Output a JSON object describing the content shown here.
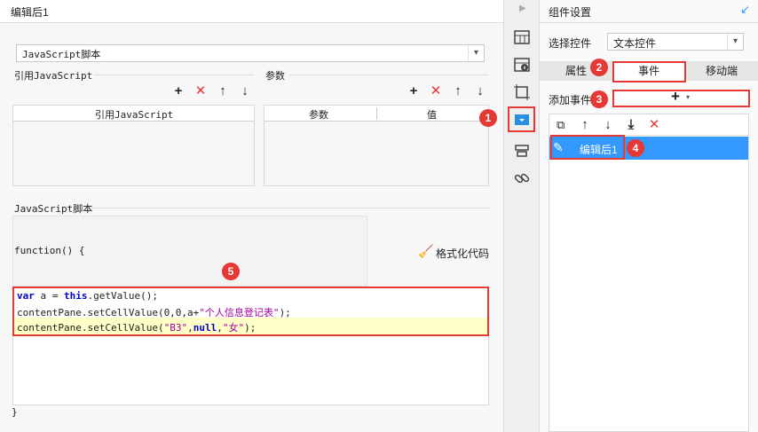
{
  "left": {
    "title": "编辑后1",
    "script_select": "JavaScript脚本",
    "ref_js_label": "引用JavaScript",
    "params_label": "参数",
    "ref_table_header": "引用JavaScript",
    "params_table_headers": [
      "参数",
      "值"
    ],
    "js_script_label": "JavaScript脚本",
    "function_open": "function() {",
    "format_code_label": "格式化代码",
    "function_close": "}",
    "code_lines": {
      "l1_kw1": "var",
      "l1_mid": " a = ",
      "l1_kw2": "this",
      "l1_end": ".getValue();",
      "l2_pre": "contentPane.setCellValue(0,0,a+",
      "l2_str": "\"个人信息登记表\"",
      "l2_end": ");",
      "l3_pre": "contentPane.setCellValue(",
      "l3_str1": "\"B3\"",
      "l3_comma1": ",",
      "l3_kw": "null",
      "l3_comma2": ",",
      "l3_str2": "\"女\"",
      "l3_end": ");"
    }
  },
  "right": {
    "title": "组件设置",
    "select_widget_label": "选择控件",
    "select_widget_value": "文本控件",
    "tabs": [
      "属性",
      "事件",
      "移动端"
    ],
    "add_event_label": "添加事件",
    "add_symbol": "+",
    "event_item": "编辑后1"
  },
  "badges": [
    "1",
    "2",
    "3",
    "4",
    "5"
  ],
  "colors": {
    "accent_blue": "#3399ff",
    "annotation_red": "#e53935",
    "highlight_yellow": "#ffffc8"
  }
}
